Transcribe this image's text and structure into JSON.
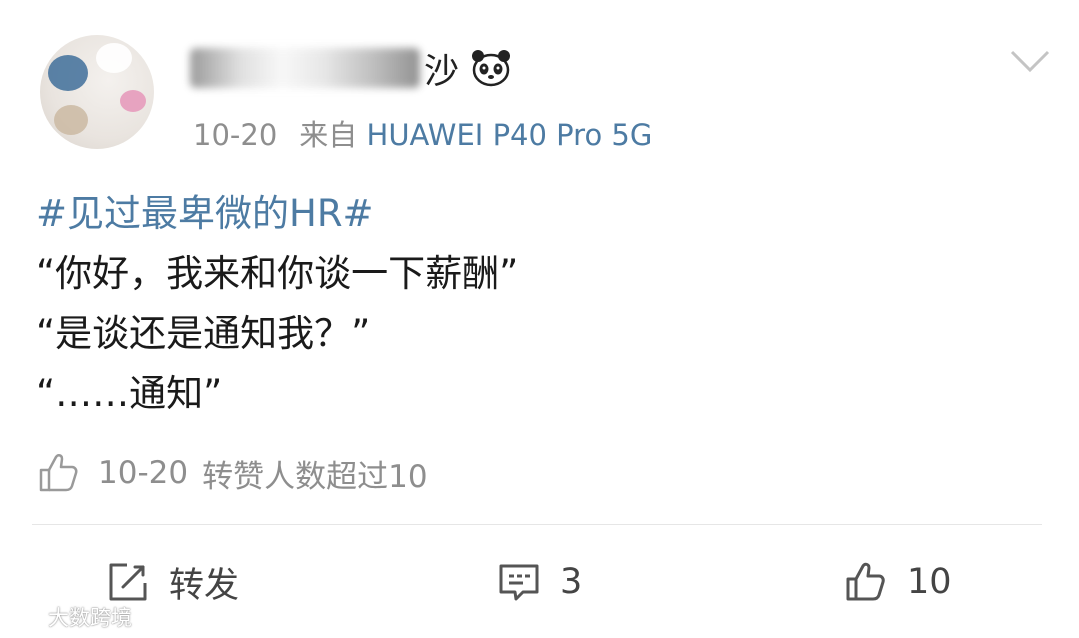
{
  "post": {
    "author_suffix": "沙",
    "date": "10-20",
    "source_prefix": "来自",
    "device": "HUAWEI P40 Pro 5G",
    "hashtag": "#见过最卑微的HR#",
    "lines": [
      "“你好，我来和你谈一下薪酬”",
      "“是谈还是通知我？”",
      "“……通知”"
    ],
    "repost_info": {
      "date": "10-20",
      "text": "转赞人数超过10"
    }
  },
  "actions": {
    "share_label": "转发",
    "comment_count": "3",
    "like_count": "10"
  },
  "watermark": {
    "text": "大数跨境"
  },
  "icons": {
    "avatar": "avatar",
    "panda": "panda-emoji-icon",
    "chevron": "chevron-down-icon",
    "thumb": "thumb-up-icon",
    "share": "share-edit-icon",
    "comment": "comment-icon",
    "like": "like-icon",
    "watermark_logo": "watermark-logo-icon"
  },
  "colors": {
    "link_blue": "#4d7ba3",
    "meta_gray": "#8e8e8e",
    "text": "#1a1a1a"
  }
}
